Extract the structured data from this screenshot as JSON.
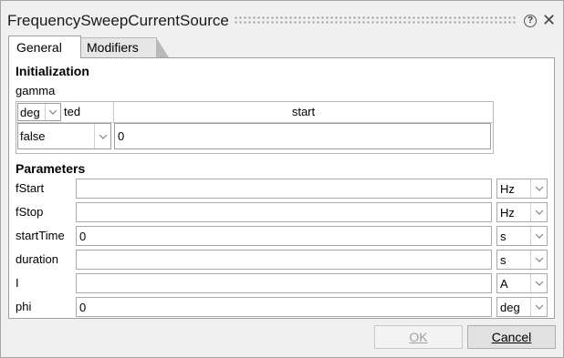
{
  "dialog": {
    "title": "FrequencySweepCurrentSource",
    "help_icon": "question-circle-icon",
    "close_icon": "close-x-icon"
  },
  "tabs": [
    {
      "label": "General",
      "active": true
    },
    {
      "label": "Modifiers",
      "active": false
    }
  ],
  "initialization": {
    "heading": "Initialization",
    "param_label": "gamma",
    "unit": "deg",
    "col1_partial": "ted",
    "col2_header": "start",
    "fixed_value": "false",
    "start_value": "0"
  },
  "parameters": {
    "heading": "Parameters",
    "rows": [
      {
        "label": "fStart",
        "value": "",
        "unit": "Hz"
      },
      {
        "label": "fStop",
        "value": "",
        "unit": "Hz"
      },
      {
        "label": "startTime",
        "value": "0",
        "unit": "s"
      },
      {
        "label": "duration",
        "value": "",
        "unit": "s"
      },
      {
        "label": "I",
        "value": "",
        "unit": "A"
      },
      {
        "label": "phi",
        "value": "0",
        "unit": "deg"
      }
    ]
  },
  "buttons": {
    "ok_label": "OK",
    "cancel_label": "Cancel"
  }
}
